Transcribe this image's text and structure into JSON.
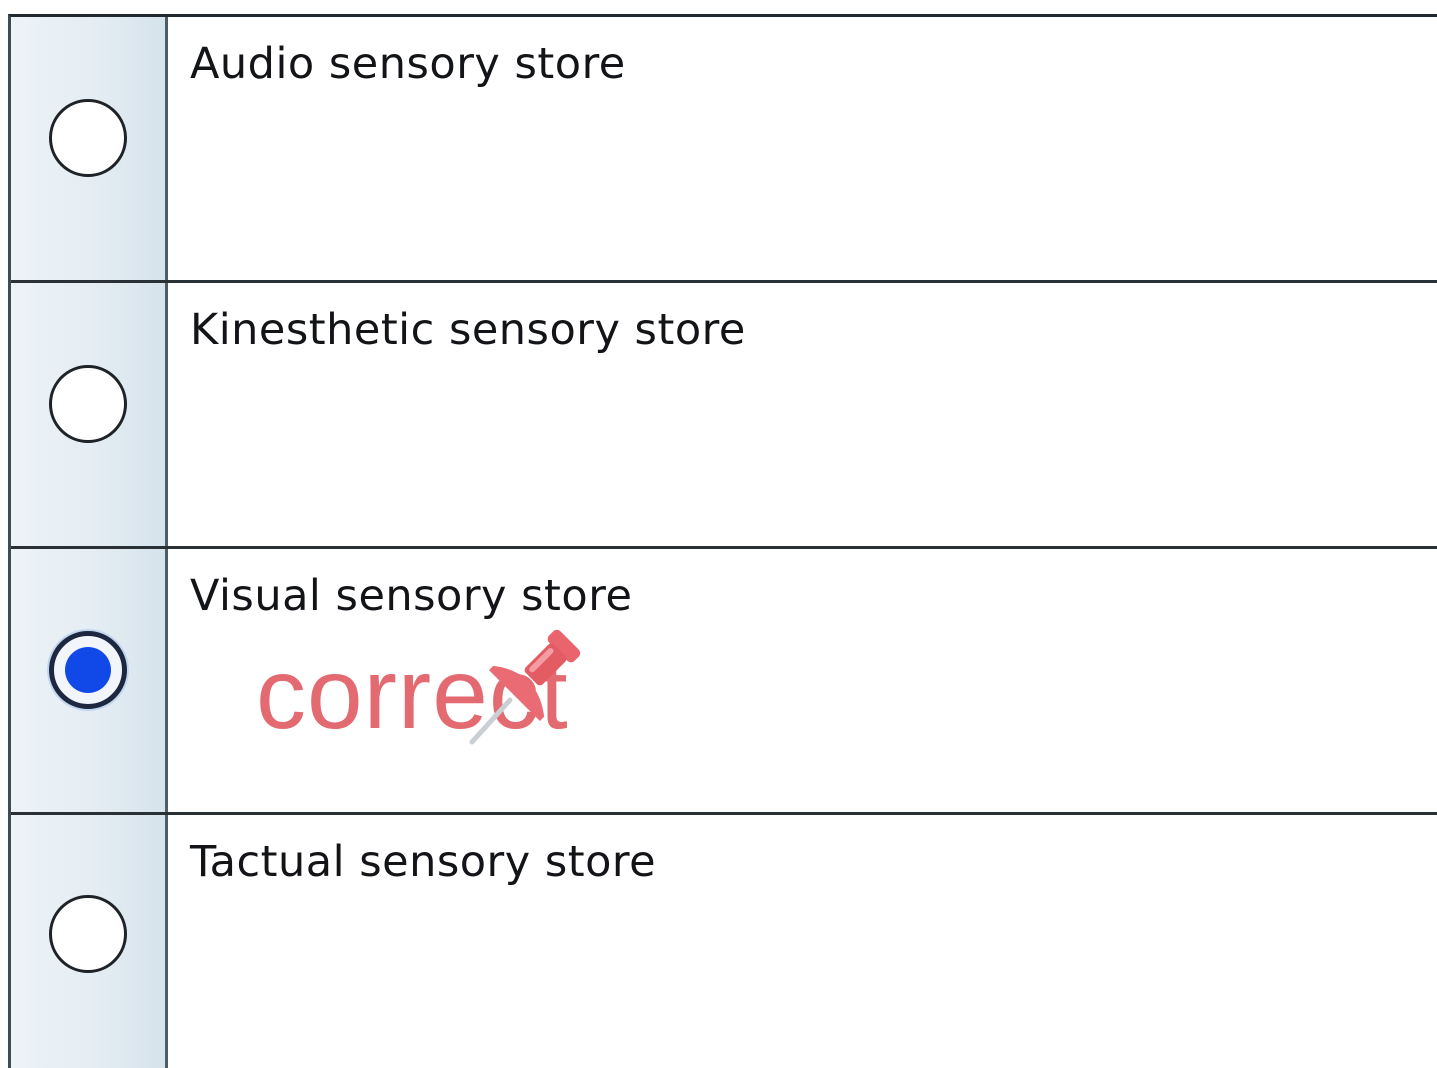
{
  "options": [
    {
      "label": "Audio sensory store",
      "selected": false
    },
    {
      "label": "Kinesthetic sensory store",
      "selected": false
    },
    {
      "label": "Visual sensory store",
      "selected": true
    },
    {
      "label": "Tactual sensory store",
      "selected": false
    }
  ],
  "feedback": {
    "text": "correct",
    "icon": "pushpin-icon",
    "color": "#e46a71"
  },
  "colors": {
    "selected_radio": "#1148e8",
    "radio_column": "#e4edf3"
  }
}
